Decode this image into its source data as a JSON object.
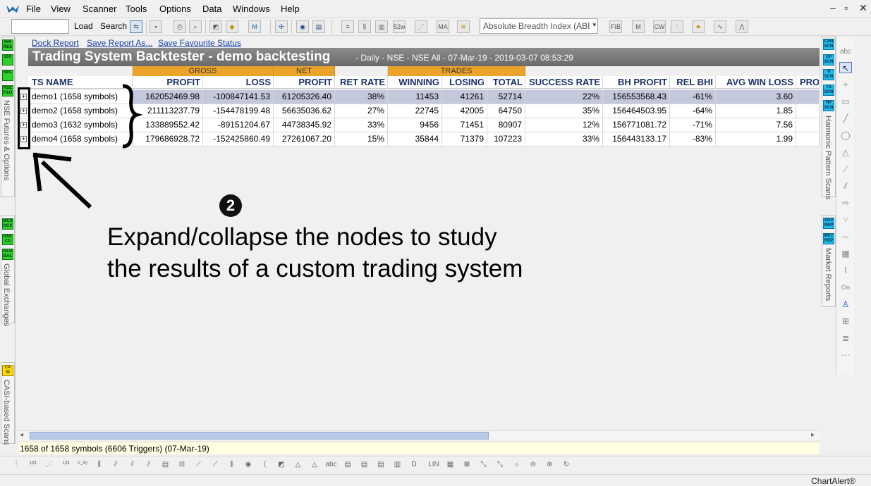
{
  "menu": {
    "items": [
      "File",
      "View",
      "Scanner",
      "Tools",
      "Options",
      "Data",
      "Windows",
      "Help"
    ]
  },
  "toolbar": {
    "load_label": "Load",
    "search_label": "Search",
    "breadth_value": "Absolute Breadth Index (ABI"
  },
  "links": {
    "dock_report": "Dock Report",
    "save_report": "Save Report As...",
    "save_fav": "Save Favourite Status"
  },
  "title": {
    "main": "Trading System Backtester - demo backtesting",
    "sub": "- Daily - NSE - NSE All - 07-Mar-19 - 2019-03-07 08:53:29"
  },
  "table": {
    "groups": {
      "gross": "GROSS",
      "net": "NET",
      "trades": "TRADES"
    },
    "columns": [
      "TS NAME",
      "PROFIT",
      "LOSS",
      "PROFIT",
      "RET RATE",
      "WINNING",
      "LOSING",
      "TOTAL",
      "SUCCESS RATE",
      "BH PROFIT",
      "REL BHI",
      "AVG WIN LOSS",
      "PRO"
    ],
    "rows": [
      {
        "name": "demo1 (1658 symbols)",
        "gross_profit": "162052469.98",
        "gross_loss": "-100847141.53",
        "net_profit": "61205326.40",
        "ret_rate": "38%",
        "winning": "11453",
        "losing": "41261",
        "total": "52714",
        "success_rate": "22%",
        "bh_profit": "156553568.43",
        "rel_bhi": "-61%",
        "avg_win_loss": "3.60"
      },
      {
        "name": "demo2 (1658 symbols)",
        "gross_profit": "211113237.79",
        "gross_loss": "-154478199.48",
        "net_profit": "56635036.62",
        "ret_rate": "27%",
        "winning": "22745",
        "losing": "42005",
        "total": "64750",
        "success_rate": "35%",
        "bh_profit": "156464503.95",
        "rel_bhi": "-64%",
        "avg_win_loss": "1.85"
      },
      {
        "name": "demo3 (1632 symbols)",
        "gross_profit": "133889552.42",
        "gross_loss": "-89151204.67",
        "net_profit": "44738345.92",
        "ret_rate": "33%",
        "winning": "9456",
        "losing": "71451",
        "total": "80907",
        "success_rate": "12%",
        "bh_profit": "156771081.72",
        "rel_bhi": "-71%",
        "avg_win_loss": "7.56"
      },
      {
        "name": "demo4 (1658 symbols)",
        "gross_profit": "179686928.72",
        "gross_loss": "-152425860.49",
        "net_profit": "27261067.20",
        "ret_rate": "15%",
        "winning": "35844",
        "losing": "71379",
        "total": "107223",
        "success_rate": "33%",
        "bh_profit": "156443133.17",
        "rel_bhi": "-83%",
        "avg_win_loss": "1.99"
      }
    ]
  },
  "left_panel": {
    "badges_top": [
      "INX RES",
      "IDX",
      "SEC",
      "NSE F&O"
    ],
    "label_top": "NSE Futures & Options",
    "badges_mid": [
      "MCX NCX",
      "NSE CD",
      "GLO BAL"
    ],
    "label_mid": "Global Exchanges",
    "badges_bot": [
      "CA SI"
    ],
    "label_bot": "CASI-based Scans"
  },
  "right_panel": {
    "badges_top": [
      "CAN SCN",
      "CP SCN",
      "TI SCN",
      "TS SCN",
      "HP SCN"
    ],
    "label_top": "Harmonic Pattern Scans",
    "badges_bot": [
      "ADV REP",
      "MKT REP"
    ],
    "label_bot": "Market Reports"
  },
  "status": {
    "text": "1658 of 1658 symbols (6606 Triggers) (07-Mar-19)"
  },
  "footer": {
    "brand": "ChartAlert®"
  },
  "annotation": {
    "number": "❷",
    "line1": "Expand/collapse the nodes to study",
    "line2": "the results of a custom trading system"
  },
  "colors": {
    "header_group": "#eba32a",
    "header_text": "#1b3169",
    "title_bar": "#777777",
    "selected_row": "#c3c8dc",
    "status_bg": "#ffffe4",
    "link": "#1a3faa"
  }
}
